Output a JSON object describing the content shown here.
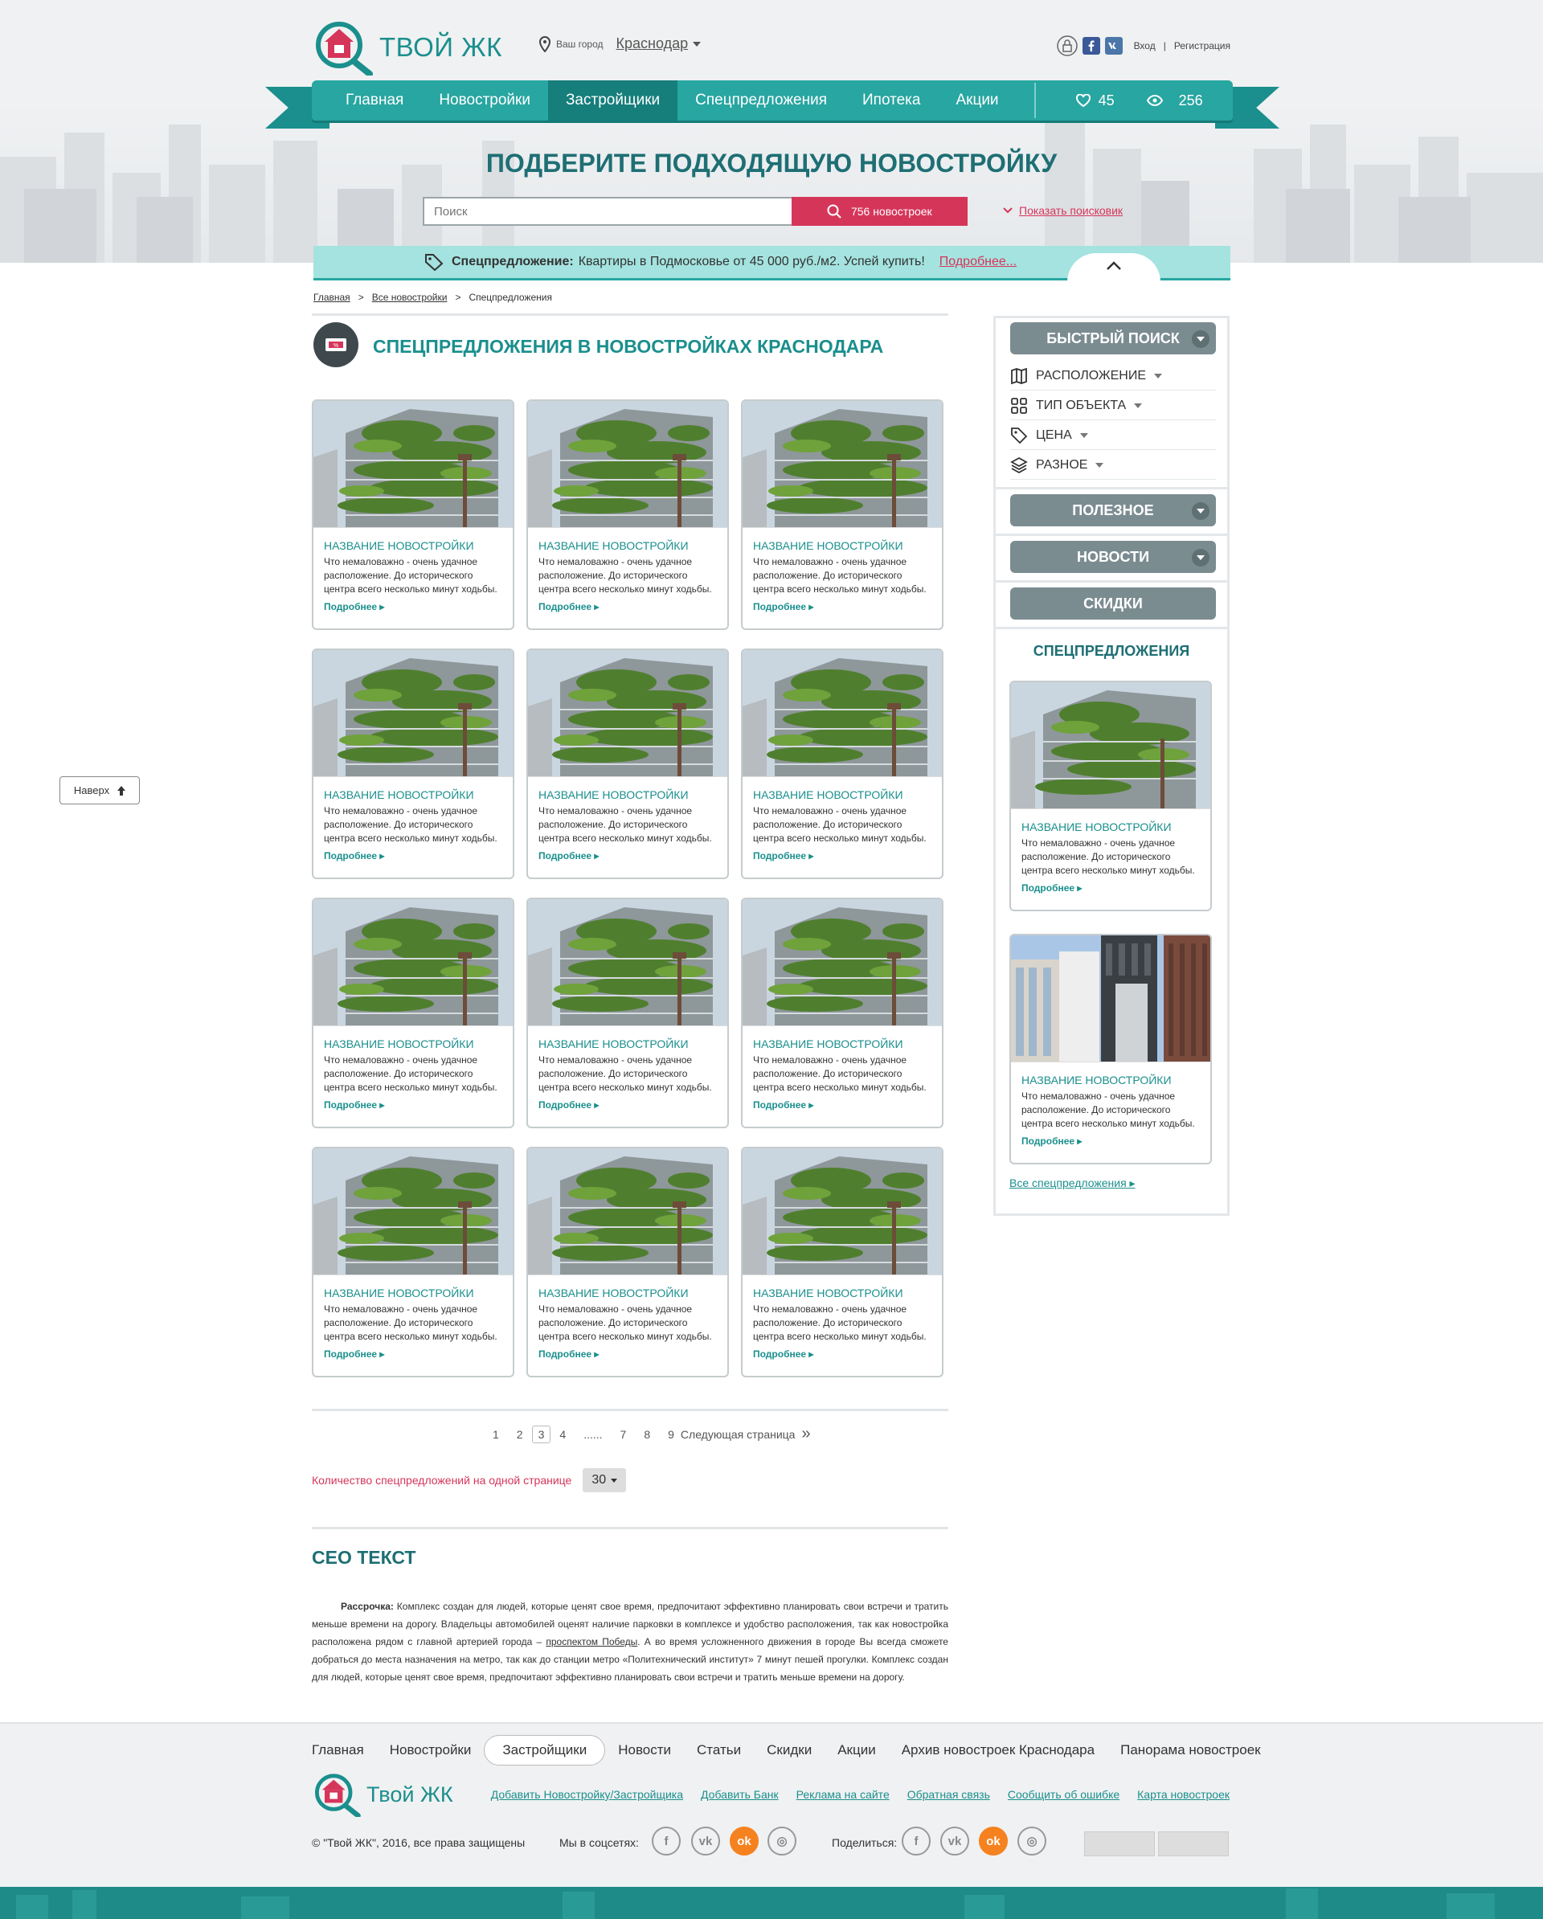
{
  "header": {
    "logo_text": "ТВОЙ ЖК",
    "city_label": "Ваш город",
    "city_value": "Краснодар",
    "login": "Вход",
    "separator": "|",
    "register": "Регистрация"
  },
  "nav": {
    "items": [
      "Главная",
      "Новостройки",
      "Застройщики",
      "Спецпредложения",
      "Ипотека",
      "Акции"
    ],
    "active_index": 2,
    "favorites_count": "45",
    "views_count": "256"
  },
  "hero": {
    "title": "ПОДБЕРИТЕ ПОДХОДЯЩУЮ НОВОСТРОЙКУ",
    "search_placeholder": "Поиск",
    "search_button": "756 новостроек",
    "show_search": "Показать поисковик"
  },
  "promo": {
    "label": "Спецпредложение:",
    "text": "Квартиры в Подмосковье от 45 000 руб./м2. Успей купить!",
    "more": "Подробнее..."
  },
  "breadcrumbs": [
    "Главная",
    ">",
    "Все новостройки",
    ">",
    "Спецпредложения"
  ],
  "section": {
    "title": "СПЕЦПРЕДЛОЖЕНИЯ В НОВОСТРОЙКАХ КРАСНОДАРА"
  },
  "cards": [
    {
      "title": "НАЗВАНИЕ НОВОСТРОЙКИ",
      "text": "Что немаловажно - очень удачное расположение. До исторического центра всего несколько минут ходьбы.",
      "more": "Подробнее"
    },
    {
      "title": "НАЗВАНИЕ НОВОСТРОЙКИ",
      "text": "Что немаловажно - очень удачное расположение. До исторического центра всего несколько минут ходьбы.",
      "more": "Подробнее"
    },
    {
      "title": "НАЗВАНИЕ НОВОСТРОЙКИ",
      "text": "Что немаловажно - очень удачное расположение. До исторического центра всего несколько минут ходьбы.",
      "more": "Подробнее"
    },
    {
      "title": "НАЗВАНИЕ НОВОСТРОЙКИ",
      "text": "Что немаловажно - очень удачное расположение. До исторического центра всего несколько минут ходьбы.",
      "more": "Подробнее"
    },
    {
      "title": "НАЗВАНИЕ НОВОСТРОЙКИ",
      "text": "Что немаловажно - очень удачное расположение. До исторического центра всего несколько минут ходьбы.",
      "more": "Подробнее"
    },
    {
      "title": "НАЗВАНИЕ НОВОСТРОЙКИ",
      "text": "Что немаловажно - очень удачное расположение. До исторического центра всего несколько минут ходьбы.",
      "more": "Подробнее"
    },
    {
      "title": "НАЗВАНИЕ НОВОСТРОЙКИ",
      "text": "Что немаловажно - очень удачное расположение. До исторического центра всего несколько минут ходьбы.",
      "more": "Подробнее"
    },
    {
      "title": "НАЗВАНИЕ НОВОСТРОЙКИ",
      "text": "Что немаловажно - очень удачное расположение. До исторического центра всего несколько минут ходьбы.",
      "more": "Подробнее"
    },
    {
      "title": "НАЗВАНИЕ НОВОСТРОЙКИ",
      "text": "Что немаловажно - очень удачное расположение. До исторического центра всего несколько минут ходьбы.",
      "more": "Подробнее"
    },
    {
      "title": "НАЗВАНИЕ НОВОСТРОЙКИ",
      "text": "Что немаловажно - очень удачное расположение. До исторического центра всего несколько минут ходьбы.",
      "more": "Подробнее"
    },
    {
      "title": "НАЗВАНИЕ НОВОСТРОЙКИ",
      "text": "Что немаловажно - очень удачное расположение. До исторического центра всего несколько минут ходьбы.",
      "more": "Подробнее"
    },
    {
      "title": "НАЗВАНИЕ НОВОСТРОЙКИ",
      "text": "Что немаловажно - очень удачное расположение. До исторического центра всего несколько минут ходьбы.",
      "more": "Подробнее"
    }
  ],
  "pagination": {
    "pages": [
      "1",
      "2",
      "3",
      "4",
      "......",
      "7",
      "8",
      "9"
    ],
    "current": "3",
    "next": "Следующая страница",
    "next_arrow": "»"
  },
  "per_page": {
    "label": "Количество спецпредложений на одной странице",
    "value": "30"
  },
  "seo": {
    "title": "СЕО ТЕКСТ",
    "lead": "Рассрочка:",
    "text_before_link": " Комплекс создан для людей, которые ценят свое время, предпочитают эффективно планировать свои встречи и тратить меньше времени на дорогу. Владельцы автомобилей оценят наличие парковки в комплексе и удобство расположения, так как новостройка расположена рядом с главной артерией города – ",
    "link": "проспектом Победы",
    "text_after_link": ". А во время усложненного движения в городе Вы всегда сможете добраться до места назначения на метро, так как до станции метро «Политехнический институт» 7 минут пешей прогулки. Комплекс создан для людей, которые ценят свое время, предпочитают эффективно планировать свои встречи и тратить меньше времени на дорогу."
  },
  "sidebar": {
    "quick_search": "БЫСТРЫЙ ПОИСК",
    "filters": [
      "РАСПОЛОЖЕНИЕ",
      "ТИП ОБЪЕКТА",
      "ЦЕНА",
      "РАЗНОЕ"
    ],
    "useful": "ПОЛЕЗНОЕ",
    "news": "НОВОСТИ",
    "discounts": "СКИДКИ",
    "offers_title": "СПЕЦПРЕДЛОЖЕНИЯ",
    "cards": [
      {
        "title": "НАЗВАНИЕ НОВОСТРОЙКИ",
        "text": "Что немаловажно - очень удачное расположение. До исторического центра всего несколько минут ходьбы.",
        "more": "Подробнее"
      },
      {
        "title": "НАЗВАНИЕ НОВОСТРОЙКИ",
        "text": "Что немаловажно - очень удачное расположение. До исторического центра всего несколько минут ходьбы.",
        "more": "Подробнее"
      }
    ],
    "all_offers": "Все спецпредложения"
  },
  "to_top": "Наверх",
  "footer": {
    "nav": [
      "Главная",
      "Новостройки",
      "Застройщики",
      "Новости",
      "Статьи",
      "Скидки",
      "Акции",
      "Архив новостроек Краснодара",
      "Панорама новостроек"
    ],
    "active_index": 2,
    "logo_text": "Твой ЖК",
    "links": [
      "Добавить Новостройку/Застройщика",
      "Добавить Банк",
      "Реклама на сайте",
      "Обратная связь",
      "Сообщить об ошибке",
      "Карта новостроек"
    ],
    "copyright": "© \"Твой ЖК\", 2016, все права защищены",
    "social_label": "Мы в соцсетях:",
    "share_label": "Поделиться:"
  },
  "colors": {
    "brand_teal": "#28a6a1",
    "dark_teal": "#1e6f74",
    "accent_red": "#d6355a",
    "promo_bg": "#a4e3df",
    "sidebar_button": "#7b8c91"
  }
}
